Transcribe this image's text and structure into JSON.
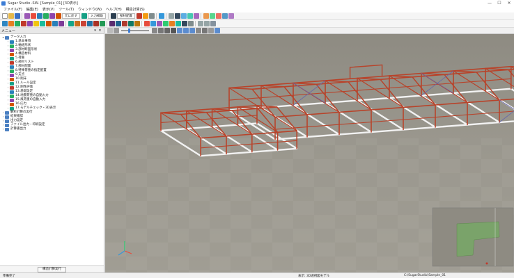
{
  "titlebar": {
    "title": "Sugar Studio -SW- [Sample_01] [3D表示]",
    "min": "—",
    "max": "☐",
    "close": "✕"
  },
  "menubar": {
    "items": [
      "ファイル(F)",
      "編集(E)",
      "表示(V)",
      "ツール(T)",
      "ウィンドウ(W)",
      "ヘルプ(H)",
      "構造計算(S)"
    ]
  },
  "toolbar1": {
    "buttons": [
      "元に戻す",
      "入力補助",
      "部材配置"
    ]
  },
  "left_panel": {
    "title": "メニュー",
    "tree": [
      {
        "label": "データ入力",
        "level": 0,
        "expanded": true
      },
      {
        "label": "1.基本事項",
        "level": 1
      },
      {
        "label": "2.軸組形状",
        "level": 1
      },
      {
        "label": "3.部材断面形状",
        "level": 1
      },
      {
        "label": "4.構造材料",
        "level": 1
      },
      {
        "label": "5.荷重",
        "level": 1
      },
      {
        "label": "6.部材リスト",
        "level": 1
      },
      {
        "label": "7.部材配置",
        "level": 1
      },
      {
        "label": "8.特殊荷重の指定配置",
        "level": 1
      },
      {
        "label": "9.支点",
        "level": 1
      },
      {
        "label": "10.剛床",
        "level": 1
      },
      {
        "label": "11.ルール設定",
        "level": 1
      },
      {
        "label": "12.剛性評価",
        "level": 1
      },
      {
        "label": "13.基礎設定",
        "level": 1
      },
      {
        "label": "14.地震荷重の自動入力",
        "level": 1
      },
      {
        "label": "15.風荷重の自動入力",
        "level": 1
      },
      {
        "label": "16.応力",
        "level": 1
      },
      {
        "label": "17.モデルチェック・3D表示",
        "level": 1
      },
      {
        "label": "解析計算の実行",
        "level": 0
      },
      {
        "label": "結果確認",
        "level": 0
      },
      {
        "label": "出力設定",
        "level": 0
      },
      {
        "label": "ファイル出力・印刷設定",
        "level": 0
      },
      {
        "label": "計算書出力",
        "level": 0
      }
    ],
    "footer_button": "構造計算実行"
  },
  "colors": {
    "frame": "#b8432a",
    "foundation": "#f2f2f2",
    "brace": "#6666aa",
    "accent": "#3a7bd5"
  },
  "statusbar": {
    "left": "準備完了",
    "center": "表示: 3D透視図モデル",
    "right": "C:\\SugarStudio\\Sample_01"
  }
}
